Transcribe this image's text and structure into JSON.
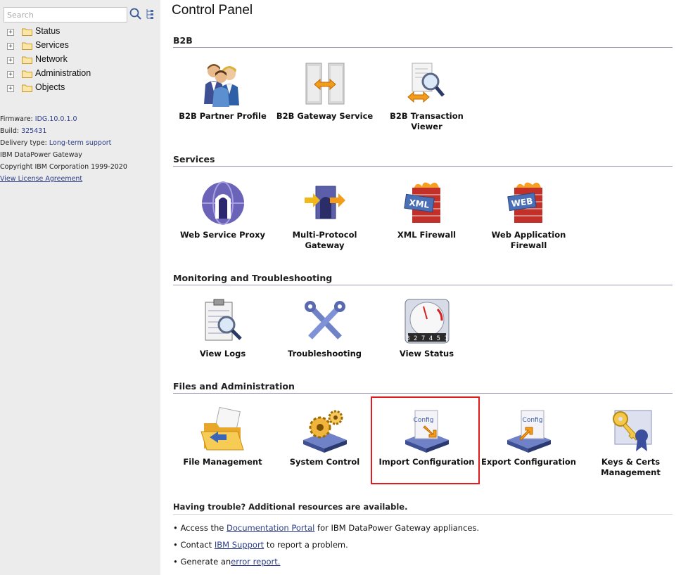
{
  "sidebar": {
    "search_placeholder": "Search",
    "tree": [
      {
        "label": "Status"
      },
      {
        "label": "Services"
      },
      {
        "label": "Network"
      },
      {
        "label": "Administration"
      },
      {
        "label": "Objects"
      }
    ],
    "info": {
      "firmware_label": "Firmware:",
      "firmware_value": "IDG.10.0.1.0",
      "build_label": "Build:",
      "build_value": "325431",
      "delivery_label": "Delivery type:",
      "delivery_value": "Long-term support",
      "product": "IBM DataPower Gateway",
      "copyright": "Copyright IBM Corporation 1999-2020",
      "license_link": "View License Agreement"
    }
  },
  "main": {
    "title": "Control Panel",
    "sections": [
      {
        "title": "B2B",
        "items": [
          {
            "label": "B2B Partner Profile",
            "icon": "partner-profile-icon"
          },
          {
            "label": "B2B Gateway Service",
            "icon": "b2b-gateway-icon"
          },
          {
            "label": "B2B Transaction Viewer",
            "icon": "transaction-viewer-icon"
          }
        ]
      },
      {
        "title": "Services",
        "items": [
          {
            "label": "Web Service Proxy",
            "icon": "globe-icon"
          },
          {
            "label": "Multi-Protocol Gateway",
            "icon": "gateway-icon"
          },
          {
            "label": "XML Firewall",
            "icon": "xml-firewall-icon",
            "badge": "XML"
          },
          {
            "label": "Web Application Firewall",
            "icon": "web-firewall-icon",
            "badge": "WEB"
          }
        ]
      },
      {
        "title": "Monitoring and Troubleshooting",
        "items": [
          {
            "label": "View Logs",
            "icon": "logs-icon"
          },
          {
            "label": "Troubleshooting",
            "icon": "tools-icon"
          },
          {
            "label": "View Status",
            "icon": "gauge-icon",
            "counter": "3 2 7 4 5 1"
          }
        ]
      },
      {
        "title": "Files and Administration",
        "items": [
          {
            "label": "File Management",
            "icon": "folder-icon"
          },
          {
            "label": "System Control",
            "icon": "gears-icon"
          },
          {
            "label": "Import Configuration",
            "icon": "import-config-icon",
            "badge": "Config"
          },
          {
            "label": "Export Configuration",
            "icon": "export-config-icon",
            "badge": "Config"
          },
          {
            "label": "Keys & Certs Management",
            "icon": "keys-icon"
          }
        ]
      }
    ],
    "trouble": {
      "heading": "Having trouble? Additional resources are available.",
      "b1_pre": "Access the ",
      "b1_link": "Documentation Portal",
      "b1_post": " for IBM DataPower Gateway appliances.",
      "b2_pre": "Contact ",
      "b2_link": "IBM Support",
      "b2_post": " to report a problem.",
      "b3_pre": "Generate an",
      "b3_link": "error report."
    }
  },
  "colors": {
    "sidebar_bg": "#ececec",
    "link": "#2c3e8c",
    "highlight": "#e01c1c",
    "section_rule": "#9a9ab6"
  }
}
